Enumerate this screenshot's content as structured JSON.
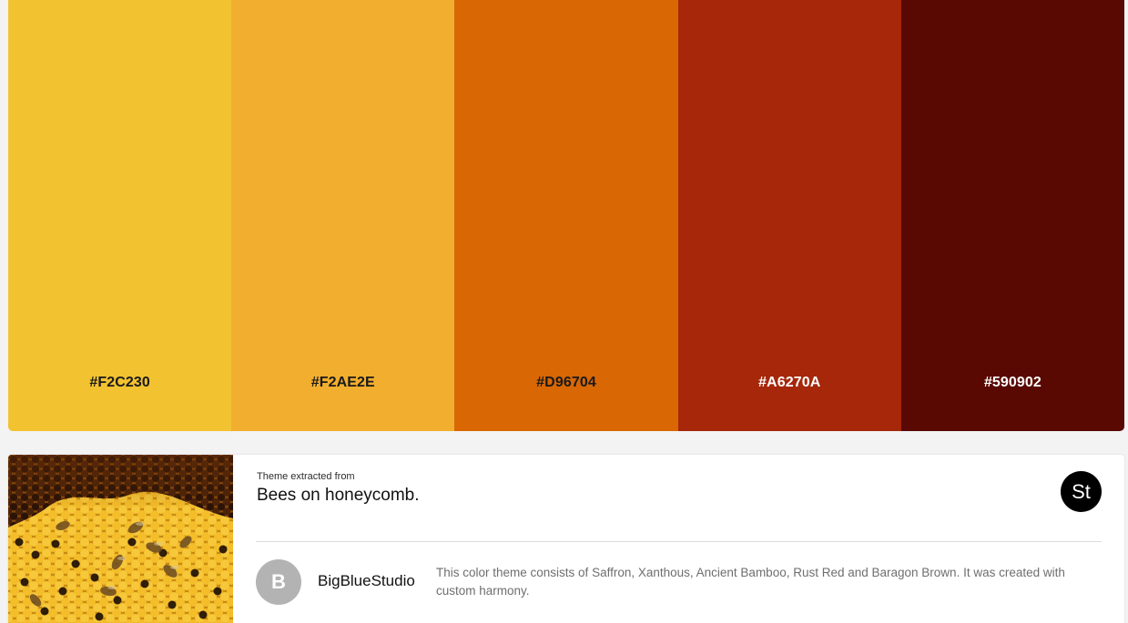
{
  "palette": {
    "swatches": [
      {
        "hex": "#F2C230",
        "color": "#F2C230",
        "text_color": "#1a1a1a"
      },
      {
        "hex": "#F2AE2E",
        "color": "#F2AE2E",
        "text_color": "#1a1a1a"
      },
      {
        "hex": "#D96704",
        "color": "#D96704",
        "text_color": "#1a1a1a"
      },
      {
        "hex": "#A6270A",
        "color": "#A6270A",
        "text_color": "#ffffff"
      },
      {
        "hex": "#590902",
        "color": "#590902",
        "text_color": "#ffffff"
      }
    ]
  },
  "source": {
    "label": "Theme extracted from",
    "title": "Bees on honeycomb.",
    "stock_icon_text": "St",
    "thumbnail_icon": "honeycomb-photo"
  },
  "author": {
    "initial": "B",
    "name": "BigBlueStudio"
  },
  "description": "This color theme consists of Saffron, Xanthous, Ancient Bamboo, Rust Red and Baragon Brown. It was created with custom harmony."
}
